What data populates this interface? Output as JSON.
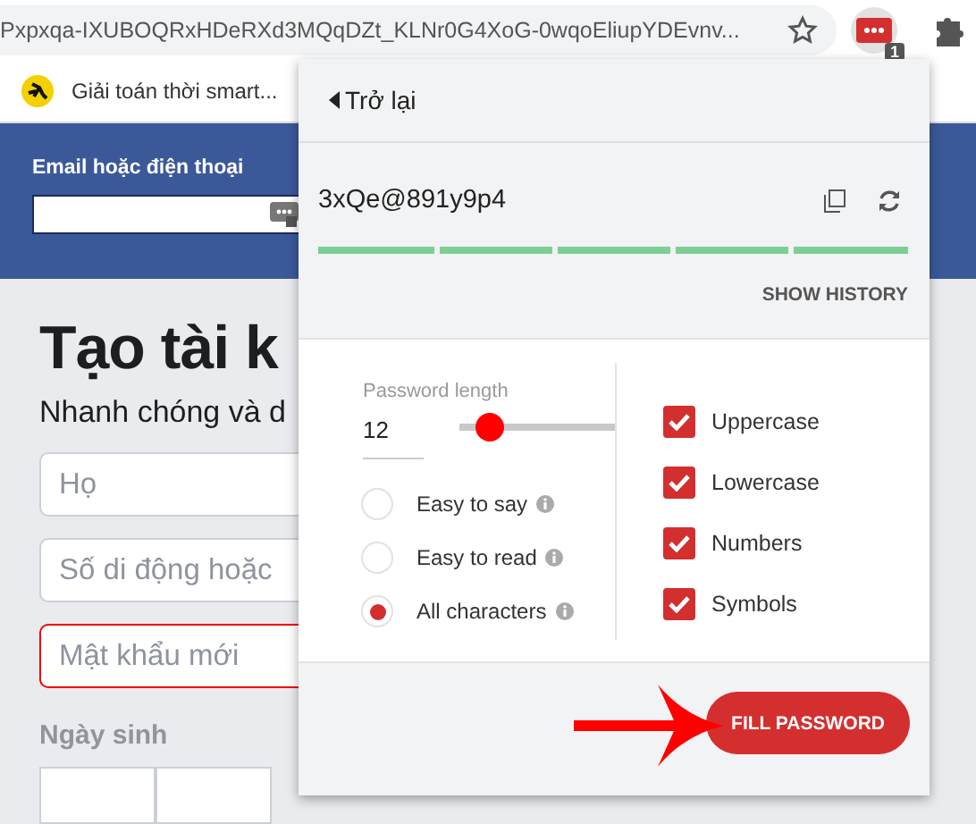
{
  "browser": {
    "url": "Pxpxqa-IXUBOQRxHDeRXd3MQqDZt_KLNr0G4XoG-0wqoEliupYDEvnv...",
    "extension_badge": "1",
    "bookmark": "Giải toán thời smart..."
  },
  "login": {
    "label": "Email hoặc điện thoại"
  },
  "signup": {
    "heading": "Tạo tài k",
    "subheading": "Nhanh chóng và d",
    "fields": [
      {
        "placeholder": "Họ",
        "error": false
      },
      {
        "placeholder": "Số di động hoặc",
        "error": false
      },
      {
        "placeholder": "Mật khẩu mới",
        "error": true
      }
    ],
    "birthday_label": "Ngày sinh"
  },
  "popup": {
    "back": "Trở lại",
    "password": "3xQe@891y9p4",
    "strength": {
      "level": 1
    },
    "show_history": "SHOW HISTORY",
    "length_label": "Password length",
    "length": "12",
    "slider": {
      "level": 0.2
    },
    "modes": [
      {
        "label": "Easy to say",
        "selected": false
      },
      {
        "label": "Easy to read",
        "selected": false
      },
      {
        "label": "All characters",
        "selected": true
      }
    ],
    "options": [
      {
        "label": "Uppercase",
        "checked": true
      },
      {
        "label": "Lowercase",
        "checked": true
      },
      {
        "label": "Numbers",
        "checked": true
      },
      {
        "label": "Symbols",
        "checked": true
      }
    ],
    "fill_button": "FILL PASSWORD"
  }
}
